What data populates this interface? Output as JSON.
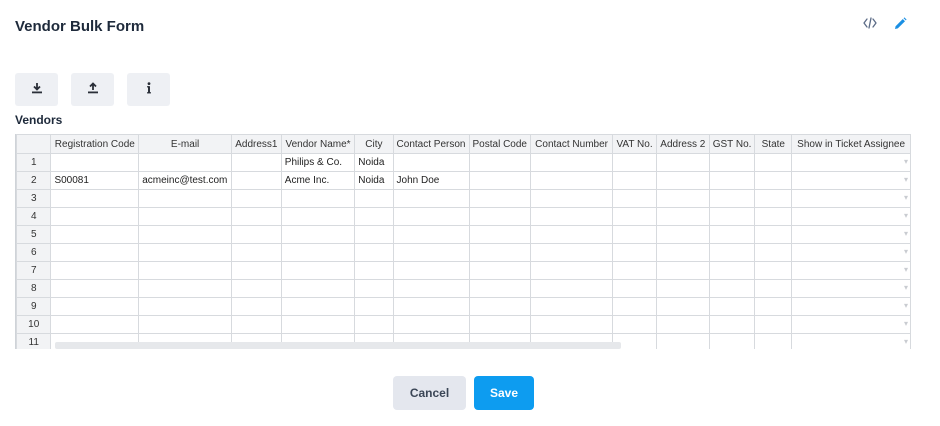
{
  "page": {
    "title": "Vendor Bulk Form"
  },
  "top_actions": {
    "code_icon": "code-icon",
    "edit_icon": "pencil-icon"
  },
  "toolbar": {
    "download_icon": "download-icon",
    "upload_icon": "upload-icon",
    "info_icon": "info-icon"
  },
  "section": {
    "label": "Vendors"
  },
  "grid": {
    "columns": [
      "Registration Code",
      "E-mail",
      "Address1",
      "Vendor Name*",
      "City",
      "Contact Person",
      "Postal Code",
      "Contact Number",
      "VAT No.",
      "Address 2",
      "GST No.",
      "State",
      "Show in Ticket Assignee"
    ],
    "rows": [
      {
        "num": "1",
        "cells": [
          "",
          "",
          "",
          "Philips & Co.",
          "Noida",
          "",
          "",
          "",
          "",
          "",
          "",
          "",
          ""
        ]
      },
      {
        "num": "2",
        "cells": [
          "S00081",
          "acmeinc@test.com",
          "",
          "Acme Inc.",
          "Noida",
          "John Doe",
          "",
          "",
          "",
          "",
          "",
          "",
          ""
        ]
      },
      {
        "num": "3",
        "cells": [
          "",
          "",
          "",
          "",
          "",
          "",
          "",
          "",
          "",
          "",
          "",
          "",
          ""
        ]
      },
      {
        "num": "4",
        "cells": [
          "",
          "",
          "",
          "",
          "",
          "",
          "",
          "",
          "",
          "",
          "",
          "",
          ""
        ]
      },
      {
        "num": "5",
        "cells": [
          "",
          "",
          "",
          "",
          "",
          "",
          "",
          "",
          "",
          "",
          "",
          "",
          ""
        ]
      },
      {
        "num": "6",
        "cells": [
          "",
          "",
          "",
          "",
          "",
          "",
          "",
          "",
          "",
          "",
          "",
          "",
          ""
        ]
      },
      {
        "num": "7",
        "cells": [
          "",
          "",
          "",
          "",
          "",
          "",
          "",
          "",
          "",
          "",
          "",
          "",
          ""
        ]
      },
      {
        "num": "8",
        "cells": [
          "",
          "",
          "",
          "",
          "",
          "",
          "",
          "",
          "",
          "",
          "",
          "",
          ""
        ]
      },
      {
        "num": "9",
        "cells": [
          "",
          "",
          "",
          "",
          "",
          "",
          "",
          "",
          "",
          "",
          "",
          "",
          ""
        ]
      },
      {
        "num": "10",
        "cells": [
          "",
          "",
          "",
          "",
          "",
          "",
          "",
          "",
          "",
          "",
          "",
          "",
          ""
        ]
      },
      {
        "num": "11",
        "cells": [
          "",
          "",
          "",
          "",
          "",
          "",
          "",
          "",
          "",
          "",
          "",
          "",
          ""
        ]
      }
    ]
  },
  "footer": {
    "cancel_label": "Cancel",
    "save_label": "Save"
  },
  "colors": {
    "primary": "#0d9cf0",
    "cancel_bg": "#e4e7ee",
    "grid_header_bg": "#f2f3f5",
    "accent_icon": "#1a8fe3"
  }
}
